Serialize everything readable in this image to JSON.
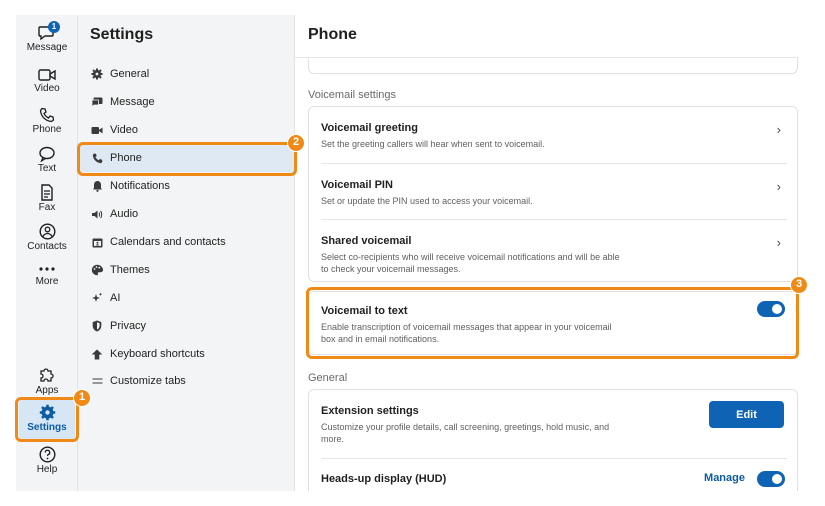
{
  "rail": {
    "message_badge": "1",
    "items": [
      {
        "label": "Message",
        "icon": "chat-bubble-icon"
      },
      {
        "label": "Video",
        "icon": "video-camera-icon"
      },
      {
        "label": "Phone",
        "icon": "phone-icon"
      },
      {
        "label": "Text",
        "icon": "text-bubble-icon"
      },
      {
        "label": "Fax",
        "icon": "fax-icon"
      },
      {
        "label": "Contacts",
        "icon": "contacts-icon"
      },
      {
        "label": "More",
        "icon": "more-dots-icon"
      },
      {
        "label": "Apps",
        "icon": "apps-puzzle-icon"
      },
      {
        "label": "Settings",
        "icon": "gear-icon"
      },
      {
        "label": "Help",
        "icon": "help-icon"
      }
    ]
  },
  "sidebar": {
    "title": "Settings",
    "items": [
      {
        "label": "General",
        "icon": "gear-icon"
      },
      {
        "label": "Message",
        "icon": "message-icon"
      },
      {
        "label": "Video",
        "icon": "video-icon"
      },
      {
        "label": "Phone",
        "icon": "phone-icon"
      },
      {
        "label": "Notifications",
        "icon": "bell-icon"
      },
      {
        "label": "Audio",
        "icon": "speaker-icon"
      },
      {
        "label": "Calendars and contacts",
        "icon": "calendar-icon"
      },
      {
        "label": "Themes",
        "icon": "palette-icon"
      },
      {
        "label": "AI",
        "icon": "sparkle-icon"
      },
      {
        "label": "Privacy",
        "icon": "shield-icon"
      },
      {
        "label": "Keyboard shortcuts",
        "icon": "keyboard-icon"
      },
      {
        "label": "Customize tabs",
        "icon": "menu-lines-icon"
      }
    ]
  },
  "main": {
    "title": "Phone",
    "voicemail_section": "Voicemail settings",
    "voicemail": {
      "greeting_title": "Voicemail greeting",
      "greeting_desc": "Set the greeting callers will hear when sent to voicemail.",
      "pin_title": "Voicemail PIN",
      "pin_desc": "Set or update the PIN used to access your voicemail.",
      "shared_title": "Shared voicemail",
      "shared_desc": "Select co-recipients who will receive voicemail notifications and will be able to check your voicemail messages."
    },
    "vm_text": {
      "title": "Voicemail to text",
      "desc": "Enable transcription of voicemail messages that appear in your voicemail box and in email notifications.",
      "enabled": true
    },
    "general_section": "General",
    "general": {
      "ext_title": "Extension settings",
      "ext_desc": "Customize your profile details, call screening, greetings, hold music, and more.",
      "edit_label": "Edit",
      "hud_title": "Heads-up display (HUD)",
      "manage_label": "Manage",
      "hud_enabled": true
    }
  },
  "callouts": [
    "1",
    "2",
    "3"
  ],
  "colors": {
    "accent": "#0e63b5",
    "callout": "#ef8a17",
    "sidebar_bg": "#f3f4f5",
    "active_bg": "#dfe9f3"
  }
}
